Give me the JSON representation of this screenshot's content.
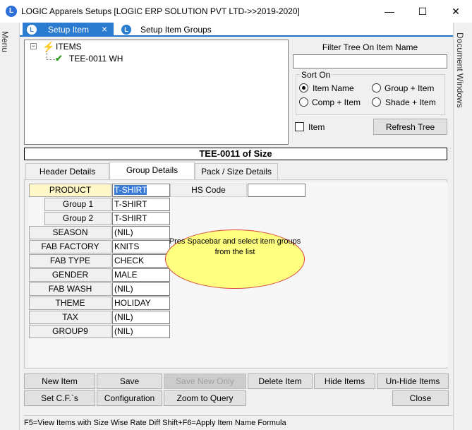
{
  "window": {
    "title": "LOGIC Apparels Setups  [LOGIC ERP SOLUTION PVT LTD->>2019-2020]",
    "minimize_glyph": "—",
    "maximize_glyph": "☐",
    "close_glyph": "✕",
    "app_icon_letter": "L"
  },
  "side": {
    "menu_label": "Menu",
    "doc_windows_label": "Document Windows"
  },
  "doc_tabs": [
    {
      "label": "Setup Item",
      "active": true,
      "close_glyph": "×"
    },
    {
      "label": "Setup Item Groups",
      "active": false
    }
  ],
  "tree": {
    "expander": "−",
    "root": {
      "label": "ITEMS",
      "icon": "lightning-icon"
    },
    "child": {
      "label": "TEE-0011 WH",
      "icon": "checkmark-icon"
    }
  },
  "filter": {
    "caption": "Filter Tree On Item Name",
    "value": ""
  },
  "sort": {
    "caption": "Sort On",
    "options": [
      {
        "label": "Item Name",
        "selected": true
      },
      {
        "label": "Group + Item",
        "selected": false
      },
      {
        "label": "Comp + Item",
        "selected": false
      },
      {
        "label": "Shade + Item",
        "selected": false
      }
    ]
  },
  "item_checkbox": {
    "label": "Item",
    "checked": false
  },
  "refresh_button": "Refresh Tree",
  "item_banner": "TEE-0011  of Size",
  "inner_tabs": [
    {
      "label": "Header Details",
      "active": false
    },
    {
      "label": "Group Details",
      "active": true
    },
    {
      "label": "Pack / Size Details",
      "active": false
    }
  ],
  "groups": [
    {
      "label": "PRODUCT",
      "value": "T-SHIRT"
    },
    {
      "label": "Group 1",
      "value": "T-SHIRT"
    },
    {
      "label": "Group 2",
      "value": "T-SHIRT"
    },
    {
      "label": "SEASON",
      "value": "(NIL)"
    },
    {
      "label": "FAB FACTORY",
      "value": "KNITS"
    },
    {
      "label": "FAB TYPE",
      "value": "CHECK"
    },
    {
      "label": "GENDER",
      "value": "MALE"
    },
    {
      "label": "FAB WASH",
      "value": "(NIL)"
    },
    {
      "label": "THEME",
      "value": "HOLIDAY"
    },
    {
      "label": "TAX",
      "value": "(NIL)"
    },
    {
      "label": "GROUP9",
      "value": "(NIL)"
    }
  ],
  "hs_code": {
    "label": "HS Code",
    "value": ""
  },
  "callout": "Pres  Spacebar  and select  item  groups  from the  list",
  "buttons": {
    "new_item": "New Item",
    "save": "Save",
    "save_new_only": "Save New Only",
    "delete_item": "Delete Item",
    "hide_items": "Hide Items",
    "unhide_items": "Un-Hide Items",
    "set_cfs": "Set C.F.`s",
    "configuration": "Configuration",
    "zoom_to_query": "Zoom to Query",
    "close": "Close"
  },
  "status": "F5=View Items with Size Wise Rate Diff    Shift+F6=Apply Item Name Formula",
  "colors": {
    "accent": "#2b7bd1",
    "callout_fill": "#ffff80",
    "callout_border": "#d84a3a",
    "product_label": "#fff7c8"
  }
}
